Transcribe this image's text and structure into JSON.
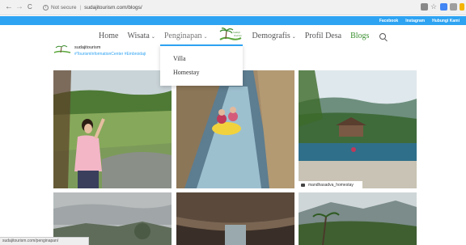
{
  "browser": {
    "back": "←",
    "forward": "→",
    "reload": "C",
    "security_label": "Not secure",
    "url": "sudajitourism.com/blogs/",
    "status_url": "sudajitourism.com/penginapan/"
  },
  "topbar": {
    "links": [
      "Facebook",
      "Instagram",
      "Hubungi Kami"
    ]
  },
  "nav": {
    "items": [
      {
        "label": "Home"
      },
      {
        "label": "Wisata"
      },
      {
        "label": "Penginapan"
      },
      {
        "label": "Demografis"
      },
      {
        "label": "Profil Desa"
      },
      {
        "label": "Blogs"
      }
    ],
    "logo_text": "Sudaji Tourism",
    "chevron": "⌄"
  },
  "site": {
    "name": "sudajitourism",
    "tagline": "#TourismInformationCenter #Embroidaji"
  },
  "dropdown": {
    "items": [
      "Villa",
      "Homestay"
    ]
  },
  "gallery": {
    "caption": "mandhasadva_homestay"
  },
  "colors": {
    "accent": "#2ea3f2",
    "blogs_green": "#3a8f2e"
  }
}
